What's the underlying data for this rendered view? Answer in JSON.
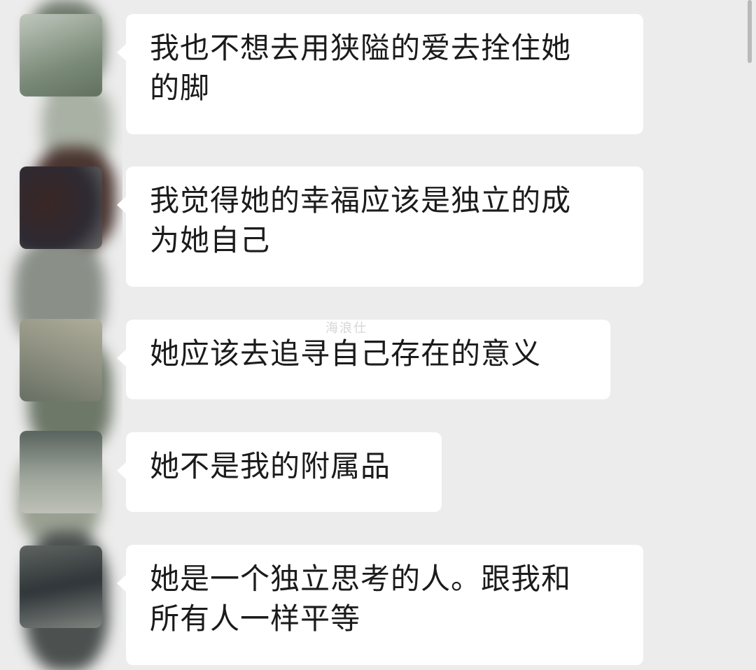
{
  "messages": [
    {
      "lines": [
        "我也不想去用狭隘的爱去拴住她",
        "的脚"
      ]
    },
    {
      "lines": [
        "我觉得她的幸福应该是独立的成",
        "为她自己"
      ]
    },
    {
      "lines": [
        "她应该去追寻自己存在的意义"
      ]
    },
    {
      "lines": [
        "她不是我的附属品"
      ]
    },
    {
      "lines": [
        "她是一个独立思考的人。跟我和",
        "所有人一样平等"
      ]
    }
  ],
  "watermark": "海浪仕",
  "colors": {
    "background": "#ececec",
    "bubble": "#ffffff",
    "text": "#1b1b1b"
  }
}
